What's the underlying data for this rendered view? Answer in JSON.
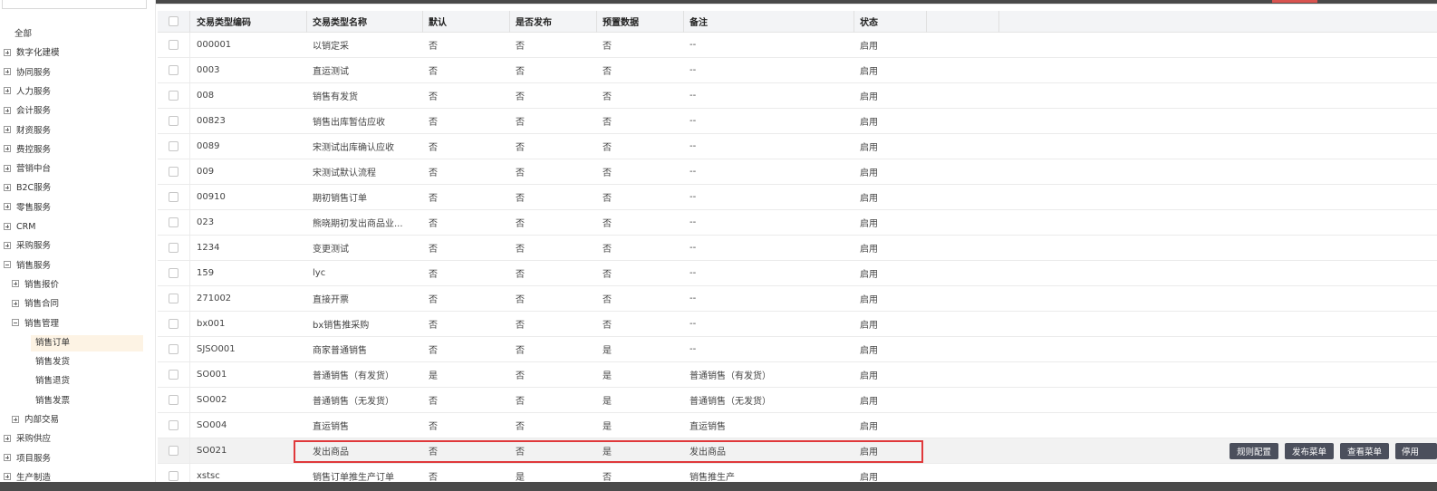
{
  "sidebar": {
    "items": [
      {
        "label": "全部",
        "toggle": "none"
      },
      {
        "label": "数字化建模",
        "toggle": "plus"
      },
      {
        "label": "协同服务",
        "toggle": "plus"
      },
      {
        "label": "人力服务",
        "toggle": "plus"
      },
      {
        "label": "会计服务",
        "toggle": "plus"
      },
      {
        "label": "财资服务",
        "toggle": "plus"
      },
      {
        "label": "费控服务",
        "toggle": "plus"
      },
      {
        "label": "营销中台",
        "toggle": "plus"
      },
      {
        "label": "B2C服务",
        "toggle": "plus"
      },
      {
        "label": "零售服务",
        "toggle": "plus"
      },
      {
        "label": "CRM",
        "toggle": "plus"
      },
      {
        "label": "采购服务",
        "toggle": "plus"
      },
      {
        "label": "销售服务",
        "toggle": "minus"
      },
      {
        "label": "销售报价",
        "toggle": "plus"
      },
      {
        "label": "销售合同",
        "toggle": "plus"
      },
      {
        "label": "销售管理",
        "toggle": "minus"
      },
      {
        "label": "销售订单",
        "toggle": "none"
      },
      {
        "label": "销售发货",
        "toggle": "none"
      },
      {
        "label": "销售退货",
        "toggle": "none"
      },
      {
        "label": "销售发票",
        "toggle": "none"
      },
      {
        "label": "内部交易",
        "toggle": "plus"
      },
      {
        "label": "采购供应",
        "toggle": "plus"
      },
      {
        "label": "项目服务",
        "toggle": "plus"
      },
      {
        "label": "生产制造",
        "toggle": "plus"
      }
    ]
  },
  "table": {
    "columns": [
      "交易类型编码",
      "交易类型名称",
      "默认",
      "是否发布",
      "预置数据",
      "备注",
      "状态"
    ],
    "rows": [
      [
        "000001",
        "以销定采",
        "否",
        "否",
        "否",
        "--",
        "启用"
      ],
      [
        "0003",
        "直运测试",
        "否",
        "否",
        "否",
        "--",
        "启用"
      ],
      [
        "008",
        "销售有发货",
        "否",
        "否",
        "否",
        "--",
        "启用"
      ],
      [
        "00823",
        "销售出库暂估应收",
        "否",
        "否",
        "否",
        "--",
        "启用"
      ],
      [
        "0089",
        "宋测试出库确认应收",
        "否",
        "否",
        "否",
        "--",
        "启用"
      ],
      [
        "009",
        "宋测试默认流程",
        "否",
        "否",
        "否",
        "--",
        "启用"
      ],
      [
        "00910",
        "期初销售订单",
        "否",
        "否",
        "否",
        "--",
        "启用"
      ],
      [
        "023",
        "熊晓期初发出商品业...",
        "否",
        "否",
        "否",
        "--",
        "启用"
      ],
      [
        "1234",
        "变更测试",
        "否",
        "否",
        "否",
        "--",
        "启用"
      ],
      [
        "159",
        "lyc",
        "否",
        "否",
        "否",
        "--",
        "启用"
      ],
      [
        "271002",
        "直接开票",
        "否",
        "否",
        "否",
        "--",
        "启用"
      ],
      [
        "bx001",
        "bx销售推采购",
        "否",
        "否",
        "否",
        "--",
        "启用"
      ],
      [
        "SJSO001",
        "商家普通销售",
        "否",
        "否",
        "是",
        "--",
        "启用"
      ],
      [
        "SO001",
        "普通销售（有发货）",
        "是",
        "否",
        "是",
        "普通销售（有发货）",
        "启用"
      ],
      [
        "SO002",
        "普通销售（无发货）",
        "否",
        "否",
        "是",
        "普通销售（无发货）",
        "启用"
      ],
      [
        "SO004",
        "直运销售",
        "否",
        "否",
        "是",
        "直运销售",
        "启用"
      ],
      [
        "SO021",
        "发出商品",
        "否",
        "否",
        "是",
        "发出商品",
        "启用"
      ],
      [
        "xstsc",
        "销售订单推生产订单",
        "否",
        "是",
        "否",
        "销售推生产",
        "启用"
      ]
    ]
  },
  "row_actions": {
    "rule_config": "规则配置",
    "publish_menu": "发布菜单",
    "view_menu": "查看菜单",
    "disable": "停用"
  },
  "colors": {
    "highlight_border": "#e0393b",
    "button_bg": "#4b4f5c",
    "selected_tree_bg": "#fdf3e4"
  }
}
